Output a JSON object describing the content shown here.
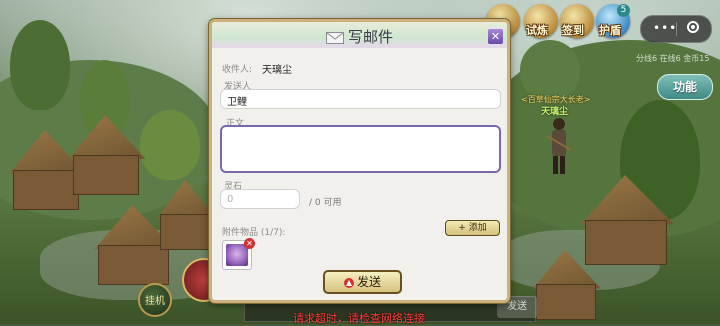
{
  "hud": {
    "trial_label": "试炼",
    "checkin_label": "签到",
    "guard_label": "护盾",
    "guard_badge": "5",
    "server_info": "分线6 在线6 金币15",
    "function_button": "功能"
  },
  "npc": {
    "title": "<百草仙宗大长老>",
    "name": "天璃尘"
  },
  "bottom": {
    "idle_label": "挂机",
    "send_label": "发送",
    "error_message": "请求超时，请检查网络连接"
  },
  "mail": {
    "title": "写邮件",
    "close_icon": "close-icon",
    "recipient_label": "收件人:",
    "recipient_name": "天璃尘",
    "sender_label": "发送人",
    "sender_value": "卫鲤",
    "body_label": "正文",
    "body_value": "",
    "stone_label": "灵石",
    "stone_placeholder": "0",
    "stone_available": "/ 0 可用",
    "attachment_label": "附件物品 (1/7):",
    "add_button": "+ 添加",
    "send_button": "发送",
    "accent_color": "#7a68a8",
    "border_color": "#cbb27a"
  }
}
